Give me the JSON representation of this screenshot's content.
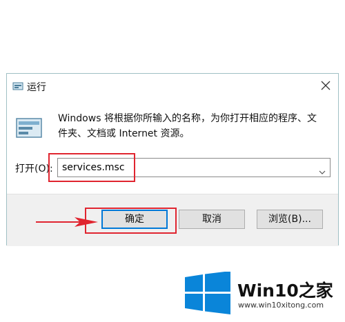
{
  "dialog": {
    "title": "运行",
    "description": "Windows 将根据你所输入的名称，为你打开相应的程序、文件夹、文档或 Internet 资源。",
    "open_label": "打开(O):",
    "command_value": "services.msc"
  },
  "buttons": {
    "ok": "确定",
    "cancel": "取消",
    "browse": "浏览(B)..."
  },
  "watermark": {
    "brand": "Win10之家",
    "url": "www.win10xitong.com"
  },
  "colors": {
    "highlight_red": "#e0242f",
    "windows_blue": "#0a85d9",
    "default_button_border": "#0078d7"
  },
  "icons": {
    "title": "run-icon",
    "close": "close-icon",
    "main": "run-large-icon",
    "dropdown": "chevron-down-icon",
    "logo": "windows-logo"
  }
}
